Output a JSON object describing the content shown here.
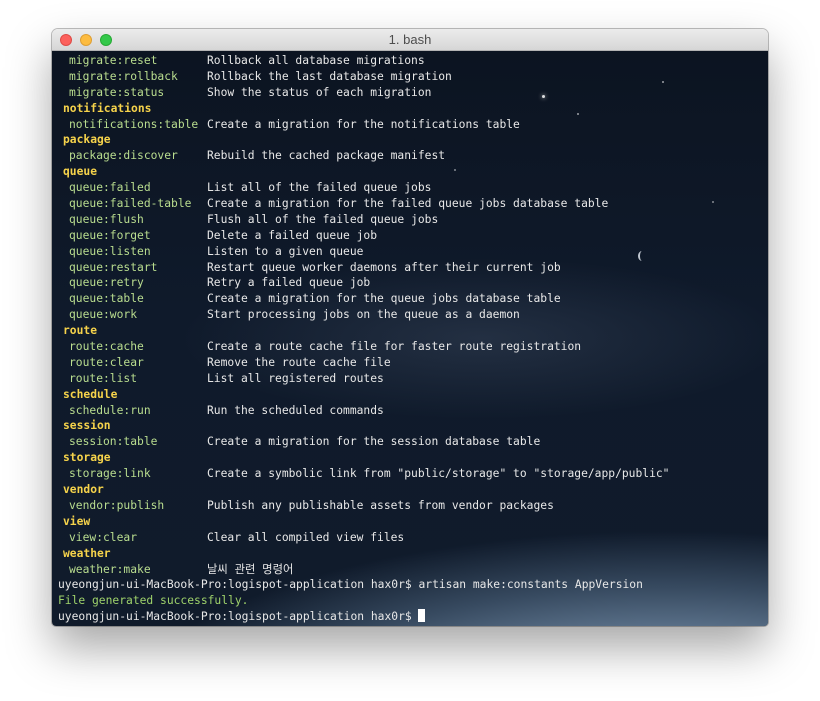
{
  "window": {
    "title": "1. bash"
  },
  "output": [
    {
      "type": "cmd",
      "command": "migrate:reset",
      "description": "Rollback all database migrations"
    },
    {
      "type": "cmd",
      "command": "migrate:rollback",
      "description": "Rollback the last database migration"
    },
    {
      "type": "cmd",
      "command": "migrate:status",
      "description": "Show the status of each migration"
    },
    {
      "type": "group",
      "text": "notifications"
    },
    {
      "type": "cmd",
      "command": "notifications:table",
      "description": "Create a migration for the notifications table"
    },
    {
      "type": "group",
      "text": "package"
    },
    {
      "type": "cmd",
      "command": "package:discover",
      "description": "Rebuild the cached package manifest"
    },
    {
      "type": "group",
      "text": "queue"
    },
    {
      "type": "cmd",
      "command": "queue:failed",
      "description": "List all of the failed queue jobs"
    },
    {
      "type": "cmd",
      "command": "queue:failed-table",
      "description": "Create a migration for the failed queue jobs database table"
    },
    {
      "type": "cmd",
      "command": "queue:flush",
      "description": "Flush all of the failed queue jobs"
    },
    {
      "type": "cmd",
      "command": "queue:forget",
      "description": "Delete a failed queue job"
    },
    {
      "type": "cmd",
      "command": "queue:listen",
      "description": "Listen to a given queue"
    },
    {
      "type": "cmd",
      "command": "queue:restart",
      "description": "Restart queue worker daemons after their current job"
    },
    {
      "type": "cmd",
      "command": "queue:retry",
      "description": "Retry a failed queue job"
    },
    {
      "type": "cmd",
      "command": "queue:table",
      "description": "Create a migration for the queue jobs database table"
    },
    {
      "type": "cmd",
      "command": "queue:work",
      "description": "Start processing jobs on the queue as a daemon"
    },
    {
      "type": "group",
      "text": "route"
    },
    {
      "type": "cmd",
      "command": "route:cache",
      "description": "Create a route cache file for faster route registration"
    },
    {
      "type": "cmd",
      "command": "route:clear",
      "description": "Remove the route cache file"
    },
    {
      "type": "cmd",
      "command": "route:list",
      "description": "List all registered routes"
    },
    {
      "type": "group",
      "text": "schedule"
    },
    {
      "type": "cmd",
      "command": "schedule:run",
      "description": "Run the scheduled commands"
    },
    {
      "type": "group",
      "text": "session"
    },
    {
      "type": "cmd",
      "command": "session:table",
      "description": "Create a migration for the session database table"
    },
    {
      "type": "group",
      "text": "storage"
    },
    {
      "type": "cmd",
      "command": "storage:link",
      "description": "Create a symbolic link from \"public/storage\" to \"storage/app/public\""
    },
    {
      "type": "group",
      "text": "vendor"
    },
    {
      "type": "cmd",
      "command": "vendor:publish",
      "description": "Publish any publishable assets from vendor packages"
    },
    {
      "type": "group",
      "text": "view"
    },
    {
      "type": "cmd",
      "command": "view:clear",
      "description": "Clear all compiled view files"
    },
    {
      "type": "group",
      "text": "weather"
    },
    {
      "type": "cmd",
      "command": "weather:make",
      "description": "날씨 관련 명령어"
    },
    {
      "type": "prompt",
      "text": "uyeongjun-ui-MacBook-Pro:logispot-application hax0r$ artisan make:constants AppVersion"
    },
    {
      "type": "success",
      "text": "File generated successfully."
    },
    {
      "type": "prompt",
      "text": "uyeongjun-ui-MacBook-Pro:logispot-application hax0r$ ",
      "cursor": true
    }
  ],
  "colors": {
    "command": "#b9dd8f",
    "group": "#f6d34b",
    "description": "#e8e8e8",
    "success": "#9fd36b"
  }
}
